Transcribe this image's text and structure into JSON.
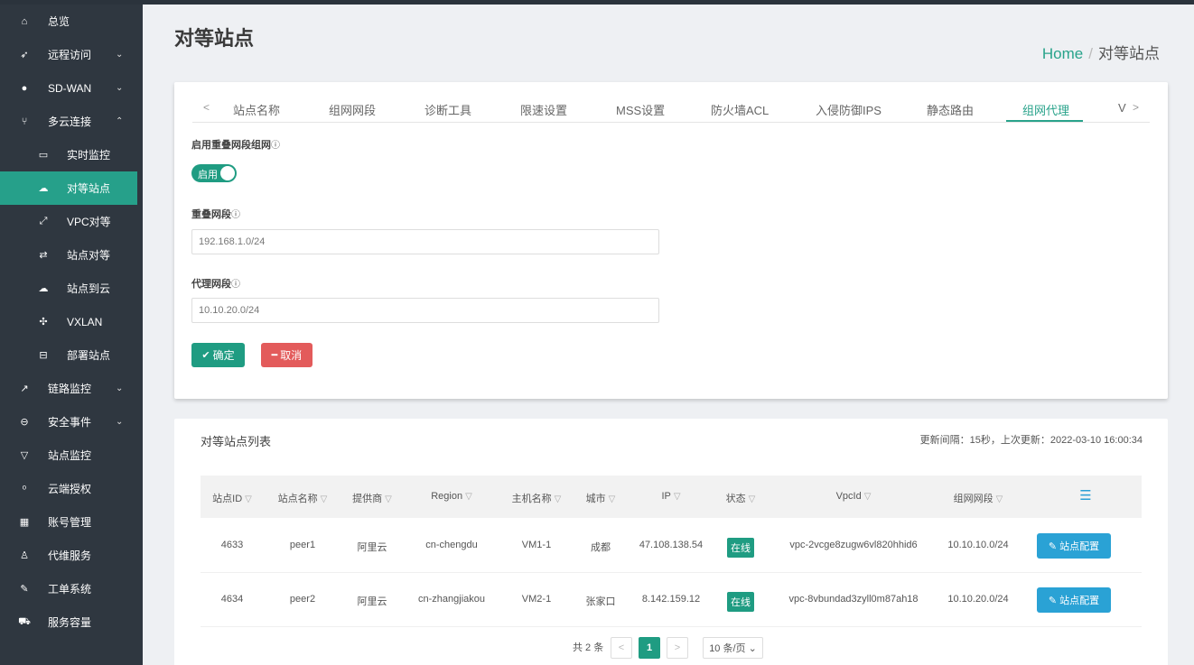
{
  "sidebar": {
    "items": [
      {
        "icon": "home-icon",
        "glyph": "⌂",
        "label": "总览",
        "chev": ""
      },
      {
        "icon": "rocket-icon",
        "glyph": "➶",
        "label": "远程访问",
        "chev": "⌄"
      },
      {
        "icon": "globe-icon",
        "glyph": "●",
        "label": "SD-WAN",
        "chev": "⌄"
      },
      {
        "icon": "fork-icon",
        "glyph": "⑂",
        "label": "多云连接",
        "chev": "⌃"
      },
      {
        "icon": "monitor-icon",
        "glyph": "▭",
        "label": "实时监控",
        "chev": "",
        "sub": true
      },
      {
        "icon": "cloud-icon",
        "glyph": "☁",
        "label": "对等站点",
        "chev": "",
        "sub": true,
        "active": true
      },
      {
        "icon": "expand-icon",
        "glyph": "⤢",
        "label": "VPC对等",
        "chev": "",
        "sub": true
      },
      {
        "icon": "sync-icon",
        "glyph": "⇄",
        "label": "站点对等",
        "chev": "",
        "sub": true
      },
      {
        "icon": "cloud-upload-icon",
        "glyph": "☁",
        "label": "站点到云",
        "chev": "",
        "sub": true
      },
      {
        "icon": "network-icon",
        "glyph": "✣",
        "label": "VXLAN",
        "chev": "",
        "sub": true
      },
      {
        "icon": "box-icon",
        "glyph": "⊟",
        "label": "部署站点",
        "chev": "",
        "sub": true
      },
      {
        "icon": "chart-icon",
        "glyph": "↗",
        "label": "链路监控",
        "chev": "⌄"
      },
      {
        "icon": "minus-circle-icon",
        "glyph": "⊖",
        "label": "安全事件",
        "chev": "⌄"
      },
      {
        "icon": "filter-icon",
        "glyph": "▽",
        "label": "站点监控",
        "chev": ""
      },
      {
        "icon": "key-icon",
        "glyph": "ᵒ",
        "label": "云端授权",
        "chev": ""
      },
      {
        "icon": "grid-icon",
        "glyph": "▦",
        "label": "账号管理",
        "chev": ""
      },
      {
        "icon": "user-icon",
        "glyph": "♙",
        "label": "代维服务",
        "chev": ""
      },
      {
        "icon": "wrench-icon",
        "glyph": "✎",
        "label": "工单系统",
        "chev": ""
      },
      {
        "icon": "cart-icon",
        "glyph": "⛟",
        "label": "服务容量",
        "chev": ""
      }
    ]
  },
  "header": {
    "title": "对等站点",
    "breadcrumb_home": "Home",
    "breadcrumb_sep": "/",
    "breadcrumb_current": "对等站点"
  },
  "tabs": {
    "prev": "<",
    "next": ">",
    "items": [
      "站点名称",
      "组网网段",
      "诊断工具",
      "限速设置",
      "MSS设置",
      "防火墙ACL",
      "入侵防御IPS",
      "静态路由",
      "组网代理",
      "V"
    ],
    "active_index": 8
  },
  "form": {
    "overlap_label": "启用重叠网段组网",
    "info_glyph": "ⓘ",
    "toggle_text": "启用",
    "overlap_segment_label": "重叠网段",
    "overlap_segment_value": "192.168.1.0/24",
    "proxy_segment_label": "代理网段",
    "proxy_segment_value": "10.10.20.0/24",
    "ok_label": "确定",
    "cancel_label": "取消"
  },
  "list": {
    "title": "对等站点列表",
    "refresh_info": "更新间隔：15秒，上次更新：2022-03-10 16:00:34",
    "columns": [
      "站点ID",
      "站点名称",
      "提供商",
      "Region",
      "主机名称",
      "城市",
      "IP",
      "状态",
      "VpcId",
      "组网网段"
    ],
    "rows": [
      {
        "id": "4633",
        "name": "peer1",
        "provider": "阿里云",
        "region": "cn-chengdu",
        "host": "VM1-1",
        "city": "成都",
        "ip": "47.108.138.54",
        "status": "在线",
        "vpcid": "vpc-2vcge8zugw6vl820hhid6",
        "segment": "10.10.10.0/24",
        "action": "站点配置"
      },
      {
        "id": "4634",
        "name": "peer2",
        "provider": "阿里云",
        "region": "cn-zhangjiakou",
        "host": "VM2-1",
        "city": "张家口",
        "ip": "8.142.159.12",
        "status": "在线",
        "vpcid": "vpc-8vbundad3zyll0m87ah18",
        "segment": "10.10.20.0/24",
        "action": "站点配置"
      }
    ],
    "pagination": {
      "total": "共 2 条",
      "prev": "<",
      "current": "1",
      "next": ">",
      "page_size": "10 条/页 ⌄"
    }
  },
  "colors": {
    "accent": "#29a38b",
    "sidebar_bg": "#2f3740",
    "danger": "#e35b5b",
    "info": "#2aa2d5"
  }
}
